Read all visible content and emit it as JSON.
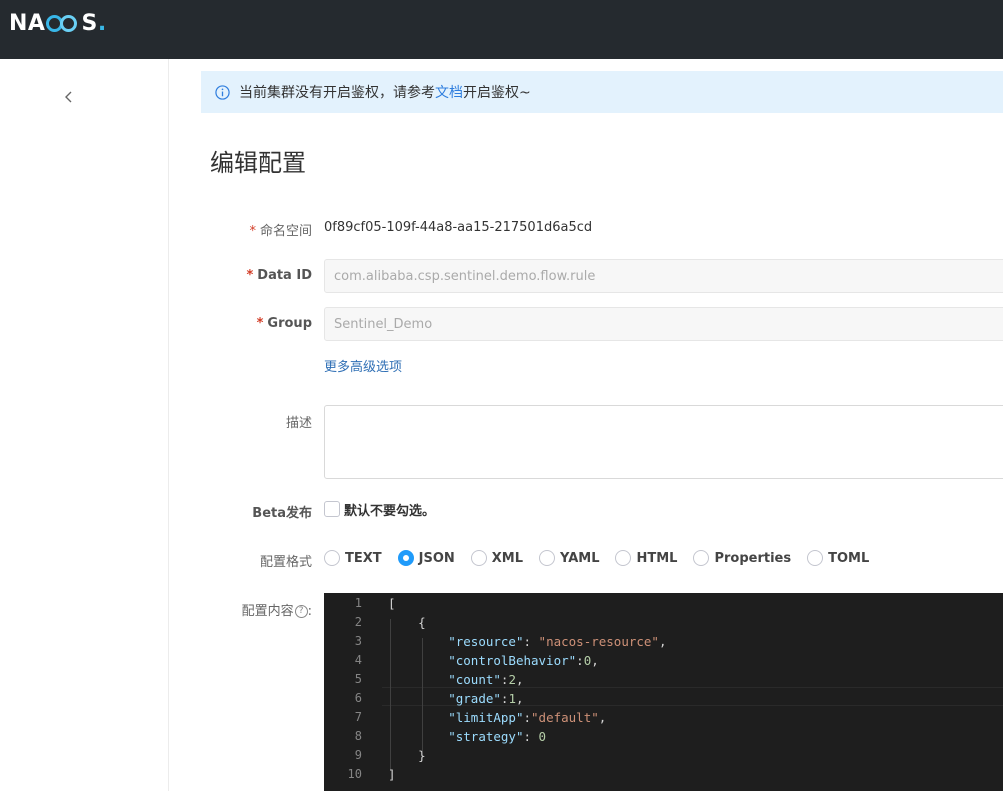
{
  "header": {
    "logo_pre": "NA",
    "logo_post": "S",
    "logo_dot": ".",
    "colors": {
      "bar": "#252a2f",
      "logo_ring": "#4fc3f7"
    }
  },
  "alert": {
    "text_before": "当前集群没有开启鉴权，请参考",
    "link": "文档",
    "text_after": "开启鉴权~"
  },
  "page_title": "编辑配置",
  "form": {
    "namespace": {
      "label": "命名空间",
      "value": "0f89cf05-109f-44a8-aa15-217501d6a5cd"
    },
    "data_id": {
      "label": "Data ID",
      "value": "com.alibaba.csp.sentinel.demo.flow.rule"
    },
    "group": {
      "label": "Group",
      "value": "Sentinel_Demo"
    },
    "more_options": "更多高级选项",
    "description": {
      "label": "描述",
      "value": ""
    },
    "beta": {
      "label": "Beta发布",
      "checkbox_label": "默认不要勾选。",
      "checked": false
    },
    "format": {
      "label": "配置格式",
      "options": [
        "TEXT",
        "JSON",
        "XML",
        "YAML",
        "HTML",
        "Properties",
        "TOML"
      ],
      "selected": "JSON"
    },
    "content": {
      "label": "配置内容",
      "help": "?",
      "colon": ":"
    },
    "required_mark": "*"
  },
  "editor": {
    "line_numbers": [
      "1",
      "2",
      "3",
      "4",
      "5",
      "6",
      "7",
      "8",
      "9",
      "10"
    ],
    "lines": [
      "[",
      "    {",
      "        \"resource\": \"nacos-resource\",",
      "        \"controlBehavior\":0,",
      "        \"count\":2,",
      "        \"grade\":1,",
      "        \"limitApp\":\"default\",",
      "        \"strategy\": 0",
      "    }",
      "]"
    ]
  }
}
